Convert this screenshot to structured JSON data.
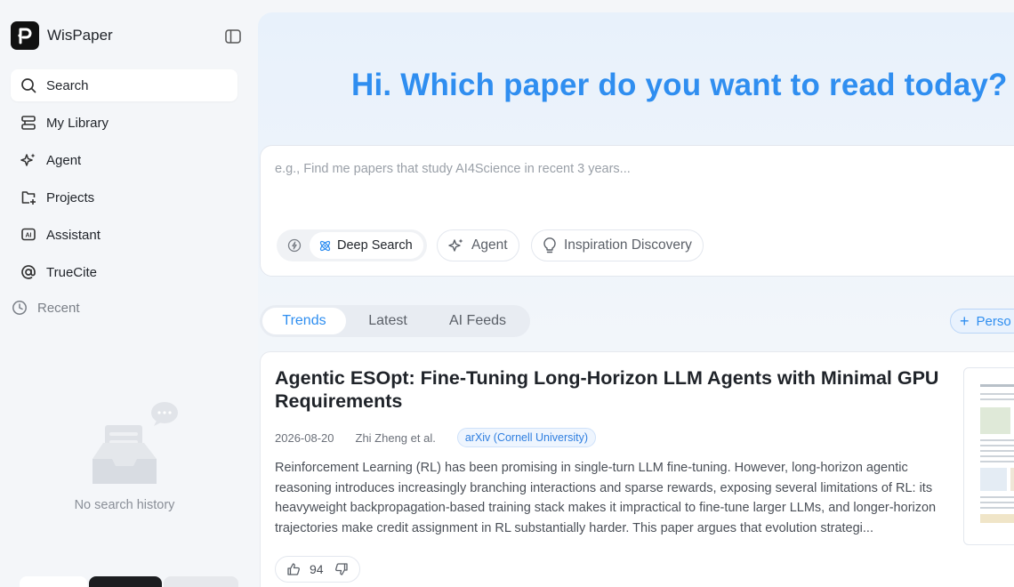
{
  "app": {
    "name": "WisPaper"
  },
  "sidebar": {
    "items": [
      {
        "label": "Search",
        "icon": "search-icon",
        "active": true
      },
      {
        "label": "My Library",
        "icon": "library-icon"
      },
      {
        "label": "Agent",
        "icon": "sparkle-icon"
      },
      {
        "label": "Projects",
        "icon": "folder-add-icon"
      },
      {
        "label": "Assistant",
        "icon": "ai-chip-icon"
      },
      {
        "label": "TrueCite",
        "icon": "at-icon"
      }
    ],
    "recent_label": "Recent",
    "empty_text": "No search history"
  },
  "main": {
    "headline": "Hi. Which paper do you want to read today?",
    "search": {
      "placeholder": "e.g., Find me papers that study AI4Science in recent 3 years...",
      "value": "",
      "modes": {
        "active": "Deep Search"
      },
      "pills": [
        "Agent",
        "Inspiration Discovery"
      ]
    },
    "tabs": [
      {
        "label": "Trends",
        "active": true
      },
      {
        "label": "Latest"
      },
      {
        "label": "AI Feeds"
      }
    ],
    "personal_label": "Perso",
    "paper": {
      "title": "Agentic ESOpt: Fine-Tuning Long-Horizon LLM Agents with Minimal GPU Requirements",
      "date": "2026-08-20",
      "authors": "Zhi Zheng et al.",
      "source": "arXiv (Cornell University)",
      "abstract": "Reinforcement Learning (RL) has been promising in single-turn LLM fine-tuning. However, long-horizon agentic reasoning introduces increasingly branching interactions and sparse rewards, exposing several limitations of RL: its heavyweight backpropagation-based training stack makes it impractical to fine-tune larger LLMs, and longer-horizon trajectories make credit assignment in RL substantially harder. This paper argues that evolution strategi...",
      "votes": "94"
    }
  },
  "colors": {
    "accent": "#2f8ef0",
    "background": "#f4f6f9"
  }
}
